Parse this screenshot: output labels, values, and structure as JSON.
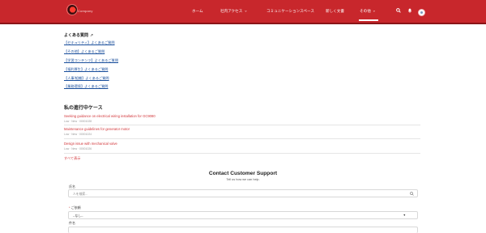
{
  "header": {
    "brand": "Company",
    "nav": [
      {
        "label": "ホーム",
        "chevron": false
      },
      {
        "label": "社内アクセス",
        "chevron": true
      },
      {
        "label": "コミュニケーションスペース",
        "chevron": false
      },
      {
        "label": "新しく文書",
        "chevron": false
      },
      {
        "label": "その他",
        "chevron": true
      }
    ],
    "active_nav": "その他",
    "icons": [
      "search-icon",
      "bell-icon",
      "settings-icon",
      "user-avatar"
    ],
    "colors": {
      "bar": "#c8272c",
      "text": "#ffffff"
    }
  },
  "faq": {
    "title": "よくある質問",
    "links": [
      "【セキュリティ】よくあるご質問",
      "【その他】よくあるご質問",
      "【学習コンテンツ】よくあるご質問",
      "【福利厚生】よくあるご質問",
      "【人事/組織】よくあるご質問",
      "【業務環境】よくあるご質問"
    ]
  },
  "cases": {
    "title": "私の進行中ケース",
    "items": [
      {
        "title": "Seeking guidance on electrical wiring installation for GC9080",
        "meta": "Low · New · 00001028"
      },
      {
        "title": "Maintenance guidelines for generator motor",
        "meta": "Low · New · 00001024"
      },
      {
        "title": "Design issue with mechanical valve",
        "meta": "Low · New · 00001026"
      }
    ],
    "view_all": "すべて表示"
  },
  "support": {
    "title": "Contact Customer Support",
    "subtitle": "Tell us how we can help.",
    "fields": {
      "name_label": "氏名",
      "name_placeholder": "人を検索...",
      "type_label": "ご依頼",
      "type_value": "--なし--",
      "subject_label": "件名"
    }
  }
}
